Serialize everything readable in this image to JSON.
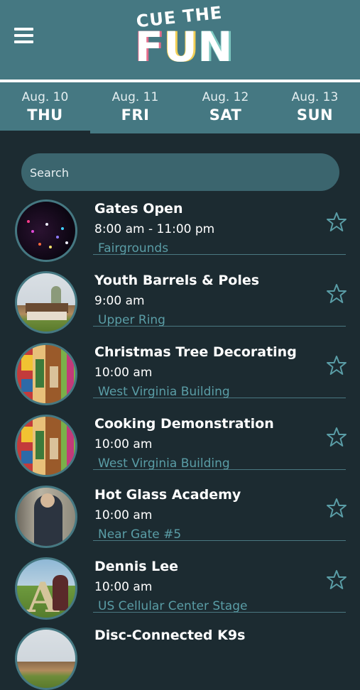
{
  "header": {
    "logo_top": "CUE THE",
    "logo_letters": [
      "F",
      "U",
      "N"
    ],
    "colors": {
      "bar": "#457882",
      "accent": "#5a9da6",
      "background": "#1c2b31"
    }
  },
  "tabs": [
    {
      "date": "Aug. 10",
      "day": "THU",
      "selected": true
    },
    {
      "date": "Aug. 11",
      "day": "FRI",
      "selected": false
    },
    {
      "date": "Aug. 12",
      "day": "SAT",
      "selected": false
    },
    {
      "date": "Aug. 13",
      "day": "SUN",
      "selected": false
    }
  ],
  "search": {
    "placeholder": "Search",
    "value": ""
  },
  "events": [
    {
      "title": "Gates Open",
      "time": "8:00 am - 11:00 pm",
      "location": "Fairgrounds",
      "favorite": false
    },
    {
      "title": "Youth Barrels & Poles",
      "time": "9:00 am",
      "location": "Upper Ring",
      "favorite": false
    },
    {
      "title": "Christmas Tree Decorating",
      "time": "10:00 am",
      "location": "West Virginia Building",
      "favorite": false
    },
    {
      "title": "Cooking Demonstration",
      "time": "10:00 am",
      "location": "West Virginia Building",
      "favorite": false
    },
    {
      "title": "Hot Glass Academy",
      "time": "10:00 am",
      "location": "Near Gate #5",
      "favorite": false
    },
    {
      "title": "Dennis Lee",
      "time": "10:00 am",
      "location": "US Cellular Center Stage",
      "favorite": false
    },
    {
      "title": "Disc-Connected K9s"
    }
  ]
}
